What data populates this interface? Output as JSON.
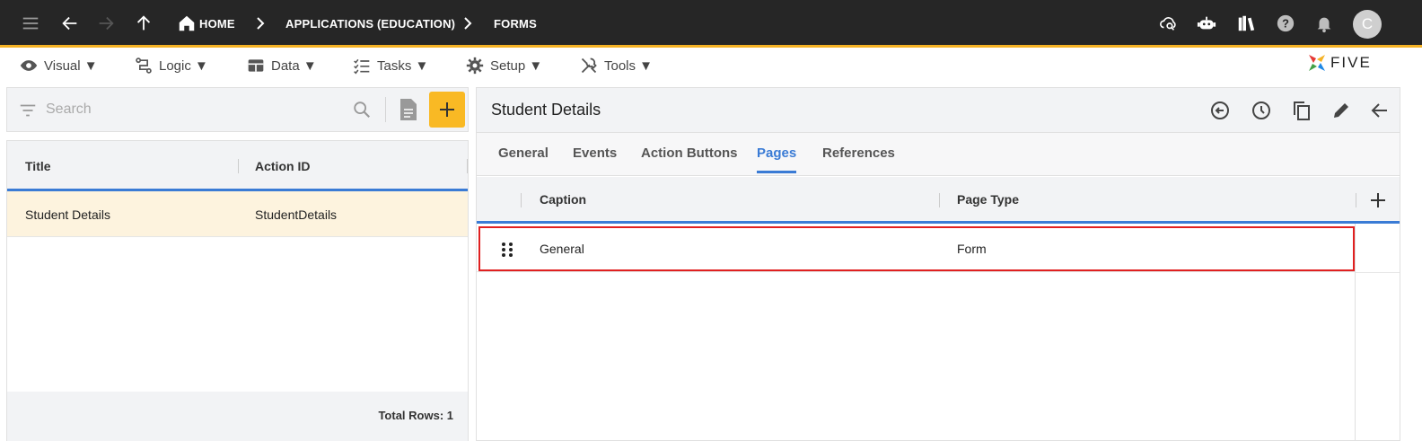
{
  "topbar": {
    "breadcrumbs": [
      "HOME",
      "APPLICATIONS (EDUCATION)",
      "FORMS"
    ],
    "avatar_letter": "C",
    "colors": {
      "background": "#262626",
      "accent": "#f5b225"
    },
    "icons": [
      "menu-icon",
      "back-arrow-icon",
      "forward-arrow-icon",
      "up-arrow-icon",
      "home-icon",
      "cloud-search-icon",
      "bot-icon",
      "library-icon",
      "help-icon",
      "bell-icon"
    ]
  },
  "menubar": {
    "items": [
      {
        "label": "Visual ▼",
        "icon": "eye-icon"
      },
      {
        "label": "Logic ▼",
        "icon": "logic-icon"
      },
      {
        "label": "Data ▼",
        "icon": "table-icon"
      },
      {
        "label": "Tasks ▼",
        "icon": "checklist-icon"
      },
      {
        "label": "Setup ▼",
        "icon": "gear-icon"
      },
      {
        "label": "Tools ▼",
        "icon": "tools-icon"
      }
    ],
    "logo_text": "FIVE"
  },
  "left": {
    "search_placeholder": "Search",
    "columns": [
      "Title",
      "Action ID"
    ],
    "rows": [
      {
        "title": "Student Details",
        "action_id": "StudentDetails"
      }
    ],
    "total_rows": "Total Rows: 1"
  },
  "detail": {
    "title": "Student Details",
    "tabs": [
      "General",
      "Events",
      "Action Buttons",
      "Pages",
      "References"
    ],
    "active_tab": "Pages",
    "grid": {
      "columns": [
        "Caption",
        "Page Type"
      ],
      "rows": [
        {
          "caption": "General",
          "page_type": "Form"
        }
      ]
    }
  }
}
